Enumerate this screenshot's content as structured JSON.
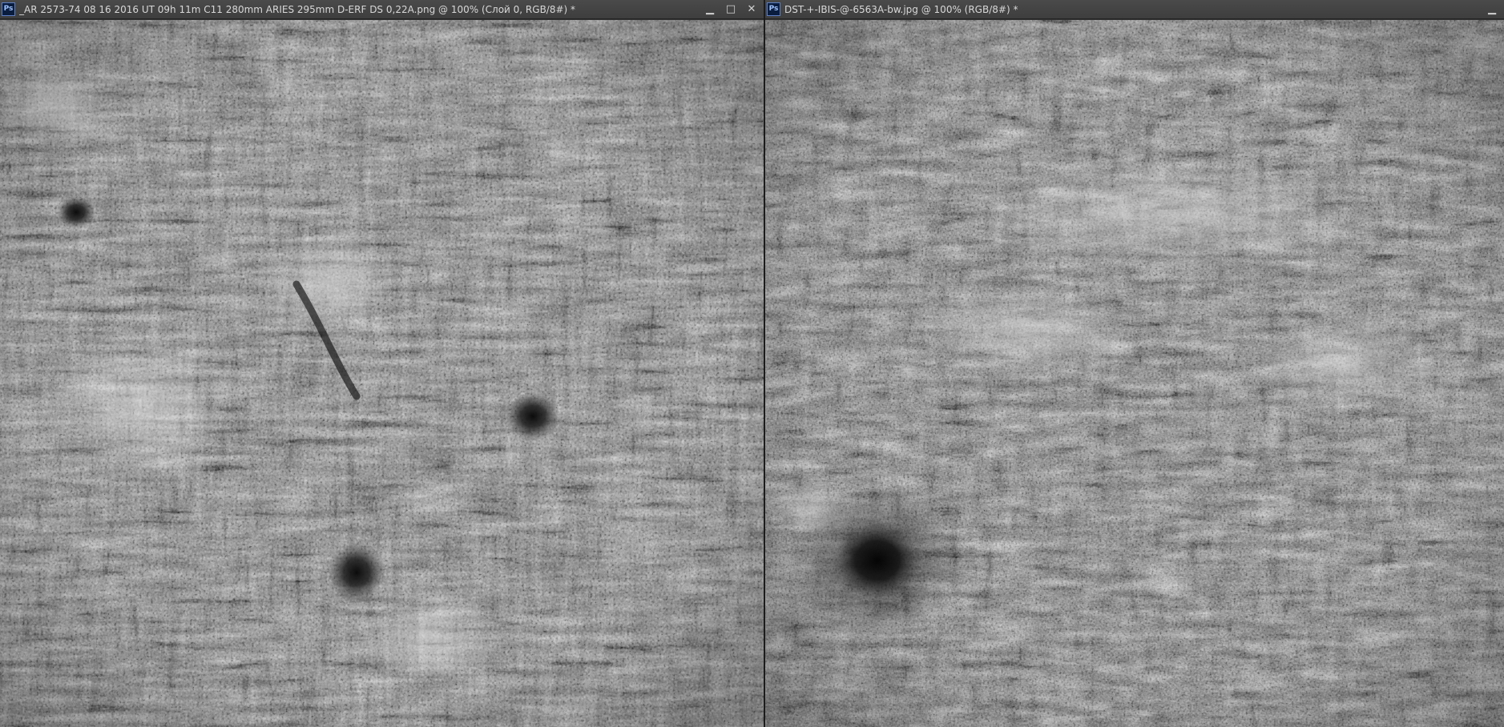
{
  "left_window": {
    "app_icon": "Ps",
    "title": "_AR 2573-74 08 16 2016 UT 09h 11m C11 280mm ARIES 295mm D-ERF DS 0,22A.png @ 100% (Слой 0, RGB/8#) *",
    "minimize": "▁",
    "maximize": "□",
    "close": "✕"
  },
  "right_window": {
    "app_icon": "Ps",
    "title": "DST-+-IBIS-@-6563A-bw.jpg @ 100% (RGB/8#) *",
    "minimize": "▁"
  },
  "colors": {
    "workspace_bg": "#282828",
    "titlebar_bg": "#444444",
    "title_text": "#d8d8d8",
    "ps_icon_bg": "#0a1d3f",
    "ps_icon_text": "#9fc3ff"
  },
  "image_content": {
    "left": "H-alpha solar chromosphere image, active region with sunspots and fibrils",
    "right": "H-alpha solar chromosphere image, large sunspot with fibrils"
  }
}
